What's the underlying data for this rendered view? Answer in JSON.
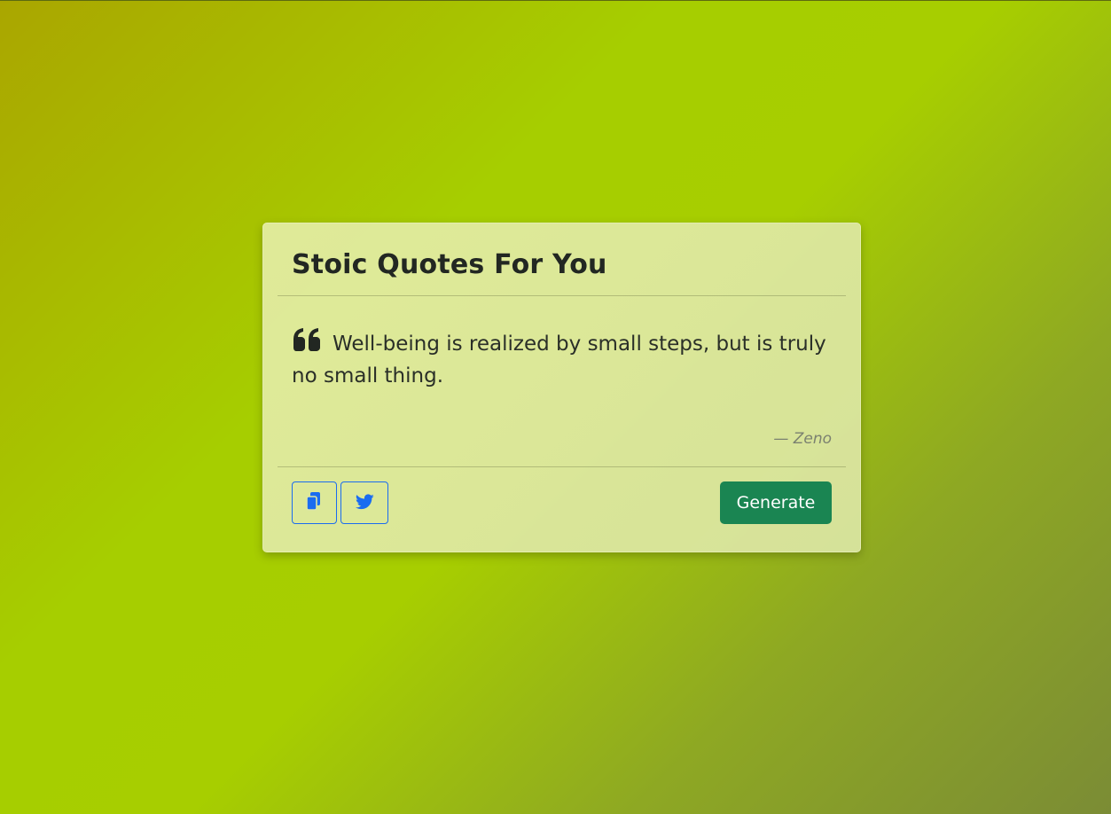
{
  "card": {
    "title": "Stoic Quotes For You",
    "quote_icon": "quote-left-icon",
    "quote_text": "Well-being is realized by small steps, but is truly no small thing.",
    "author": "— Zeno"
  },
  "actions": {
    "copy_icon": "copy-icon",
    "twitter_icon": "twitter-icon",
    "generate_label": "Generate"
  },
  "colors": {
    "generate_button": "#1a8552",
    "icon_button_accent": "#1a6cf0",
    "title_text": "#222722"
  }
}
